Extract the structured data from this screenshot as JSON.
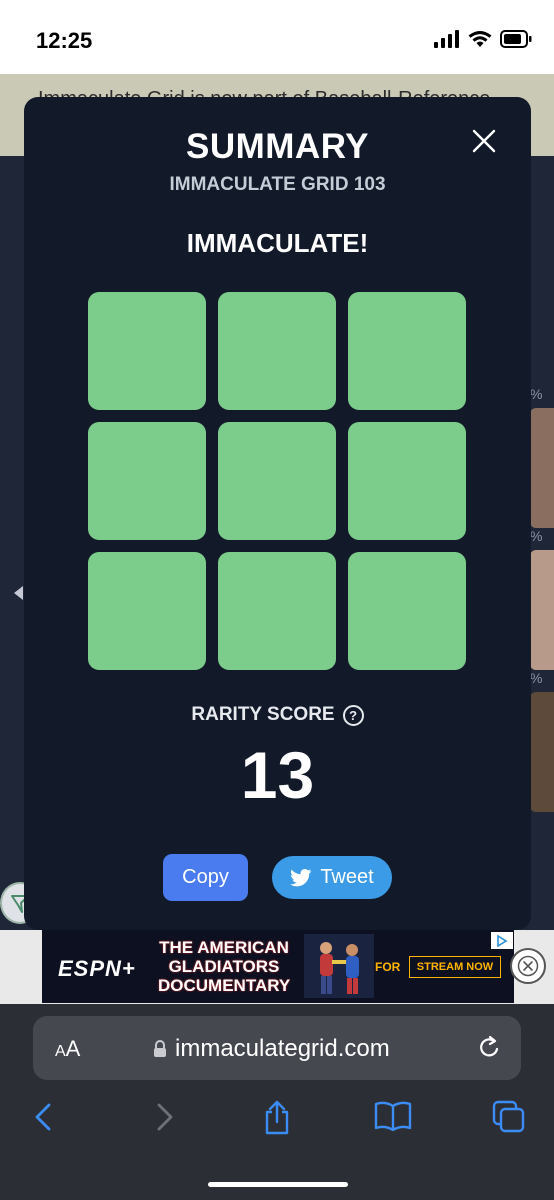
{
  "status_bar": {
    "time": "12:25"
  },
  "background": {
    "banner_text": "Immaculate Grid is now part of Baseball-Reference",
    "percent_marks": [
      "%",
      "%",
      "%"
    ]
  },
  "modal": {
    "title": "SUMMARY",
    "subtitle": "IMMACULATE GRID 103",
    "result": "IMMACULATE!",
    "grid": {
      "rows": 3,
      "cols": 3,
      "cells": [
        "correct",
        "correct",
        "correct",
        "correct",
        "correct",
        "correct",
        "correct",
        "correct",
        "correct"
      ],
      "correct_color": "#7ccc8b"
    },
    "rarity_label": "RARITY SCORE",
    "rarity_help_glyph": "?",
    "rarity_score": "13",
    "copy_label": "Copy",
    "tweet_label": "Tweet",
    "copy_color": "#4a7cf0",
    "tweet_color": "#3c9be6"
  },
  "ad": {
    "brand": "ESPN+",
    "headline_lines": [
      "THE AMERICAN",
      "GLADIATORS",
      "DOCUMENTARY"
    ],
    "for_label": "FOR",
    "cta": "STREAM NOW"
  },
  "browser": {
    "aa_label_small": "A",
    "aa_label_large": "A",
    "url": "immaculategrid.com",
    "icons": [
      "back-icon",
      "forward-icon",
      "share-icon",
      "bookmarks-icon",
      "tabs-icon"
    ]
  }
}
